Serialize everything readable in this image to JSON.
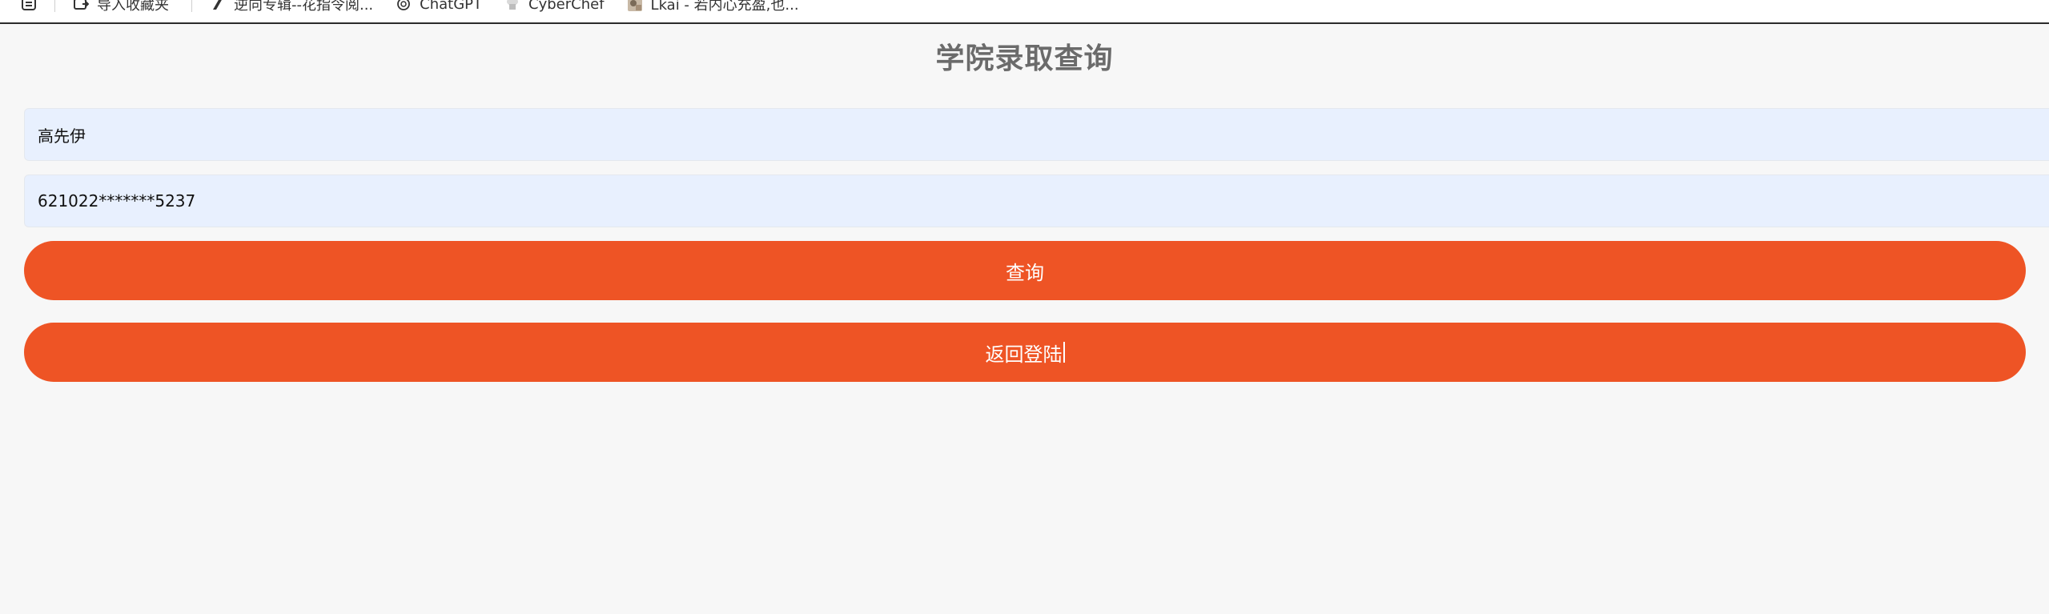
{
  "bookmarks": {
    "items": [
      {
        "label": "导入收藏夹",
        "icon": "import-bookmarks-icon"
      },
      {
        "label": "逆向专辑--花指令阅...",
        "icon": "zhihu-icon"
      },
      {
        "label": "ChatGPT",
        "icon": "chatgpt-icon"
      },
      {
        "label": "CyberChef",
        "icon": "cyberchef-icon"
      },
      {
        "label": "Lkai - 若内心充盈,也...",
        "icon": "avatar-icon"
      }
    ]
  },
  "page": {
    "title": "学院录取查询"
  },
  "form": {
    "name_value": "高先伊",
    "id_value": "621022*******5237"
  },
  "buttons": {
    "query_label": "查询",
    "back_label": "返回登陆"
  },
  "colors": {
    "accent": "#ee5425",
    "input_bg": "#e8f0fe",
    "page_bg": "#f7f7f7",
    "title": "#6b6b6b"
  }
}
